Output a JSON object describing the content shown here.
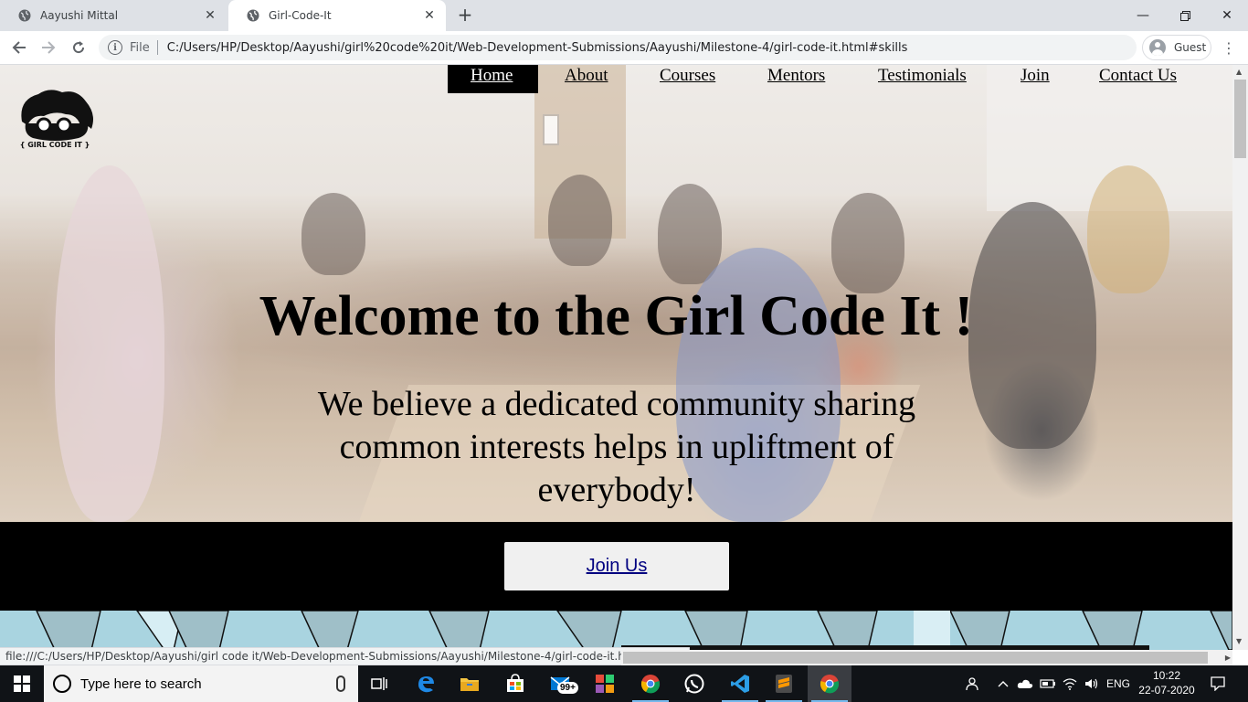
{
  "browser": {
    "tabs": [
      {
        "title": "Aayushi Mittal",
        "active": false
      },
      {
        "title": "Girl-Code-It",
        "active": true
      }
    ],
    "new_tab_label": "+",
    "address": {
      "scheme_label": "File",
      "url": "C:/Users/HP/Desktop/Aayushi/girl%20code%20it/Web-Development-Submissions/Aayushi/Milestone-4/girl-code-it.html#skills"
    },
    "profile_label": "Guest",
    "status_url": "file:///C:/Users/HP/Desktop/Aayushi/girl code it/Web-Development-Submissions/Aayushi/Milestone-4/girl-code-it.html#home"
  },
  "page": {
    "logo_text": "{ GIRL CODE IT }",
    "nav": [
      {
        "label": "Home",
        "active": true
      },
      {
        "label": "About",
        "active": false
      },
      {
        "label": "Courses",
        "active": false
      },
      {
        "label": "Mentors",
        "active": false
      },
      {
        "label": "Testimonials",
        "active": false
      },
      {
        "label": "Join",
        "active": false
      },
      {
        "label": "Contact Us",
        "active": false
      }
    ],
    "hero_title": "Welcome to the Girl Code It !",
    "hero_subtitle": "We believe a dedicated community sharing common interests helps in upliftment of everybody!",
    "join_button": "Join Us"
  },
  "taskbar": {
    "search_placeholder": "Type here to search",
    "mail_badge": "99+",
    "language": "ENG",
    "time": "10:22",
    "date": "22-07-2020"
  },
  "colors": {
    "tabstrip": "#dee1e6",
    "nav_active_bg": "#000000",
    "join_band": "#000000",
    "join_button_bg": "#f0f0f0",
    "pattern": "#a9d4e0",
    "taskbar": "#101317"
  }
}
